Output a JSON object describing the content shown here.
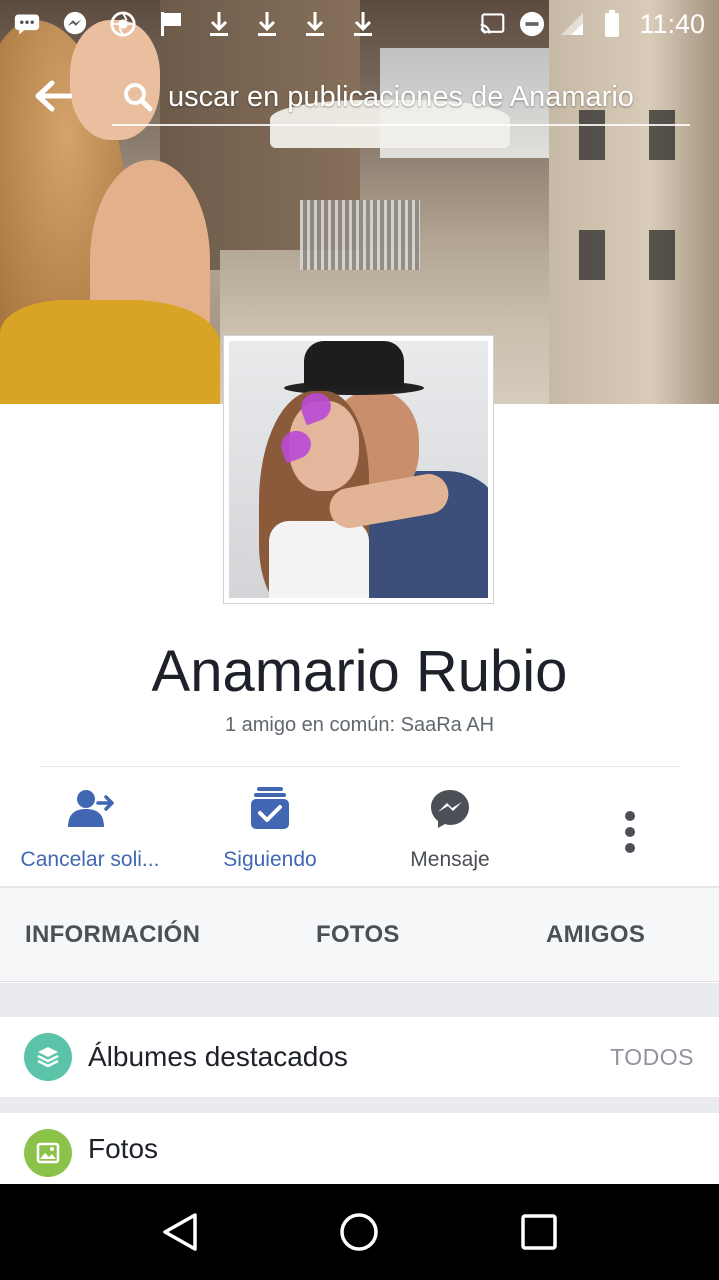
{
  "status_bar": {
    "time": "11:40",
    "left_icons": [
      "chat-icon",
      "messenger-icon",
      "shutter-icon",
      "flag-icon",
      "download-icon",
      "download-icon",
      "download-icon",
      "download-icon"
    ],
    "right_icons": [
      "cast-icon",
      "do-not-disturb-icon",
      "signal-icon",
      "battery-icon"
    ]
  },
  "header": {
    "search_text": "uscar en publicaciones de Anamario"
  },
  "profile": {
    "name": "Anamario Rubio",
    "mutual_friends": "1 amigo en común: SaaRa AH"
  },
  "actions": [
    {
      "label": "Cancelar soli...",
      "icon": "cancel-request-icon"
    },
    {
      "label": "Siguiendo",
      "icon": "following-check-icon"
    },
    {
      "label": "Mensaje",
      "icon": "messenger-icon"
    }
  ],
  "tabs": [
    "INFORMACIÓN",
    "FOTOS",
    "AMIGOS"
  ],
  "sections": {
    "albums": {
      "title": "Álbumes destacados",
      "link": "TODOS",
      "icon": "layers-icon"
    },
    "photos": {
      "title": "Fotos",
      "icon": "image-icon"
    }
  },
  "colors": {
    "accent": "#4267b2",
    "albums_icon_bg": "#5bc3a7",
    "photos_icon_bg": "#8bc34a"
  }
}
